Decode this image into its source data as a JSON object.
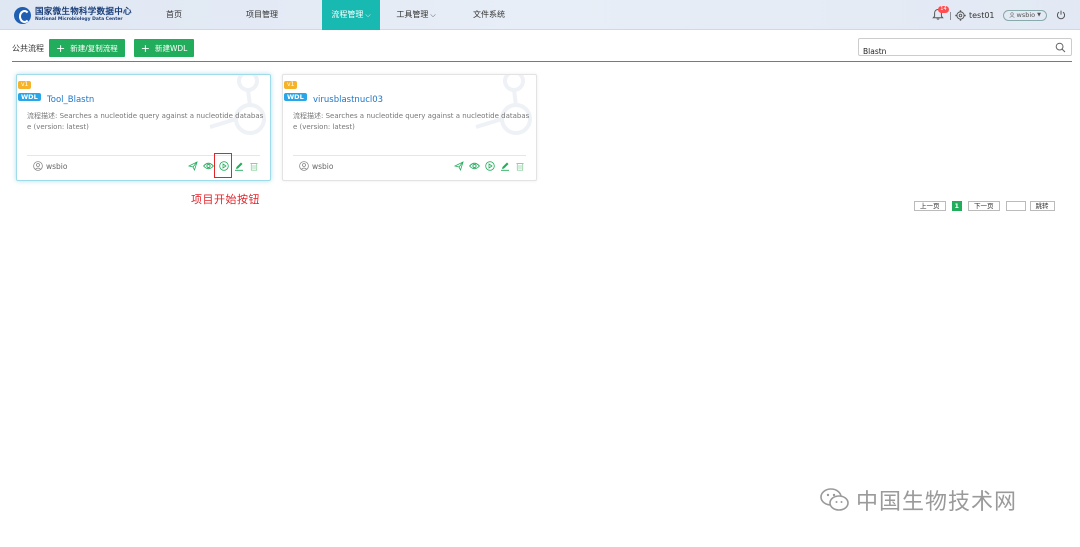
{
  "header": {
    "logo_cn": "国家微生物科学数据中心",
    "logo_en": "National Microbiology Data Center",
    "nav": [
      {
        "label": "首页",
        "chevron": false,
        "active": false
      },
      {
        "label": "项目管理",
        "chevron": false,
        "active": false
      },
      {
        "label": "流程管理",
        "chevron": true,
        "active": true
      },
      {
        "label": "工具管理",
        "chevron": true,
        "active": false
      },
      {
        "label": "文件系统",
        "chevron": false,
        "active": false
      }
    ],
    "notification_count": "14",
    "separator": "|",
    "username": "test01",
    "role": "wsbio"
  },
  "toolbar": {
    "breadcrumb": "公共流程",
    "new_copy_label": "新建/复制流程",
    "new_wdl_label": "新建WDL"
  },
  "search": {
    "value": "Blastn",
    "placeholder": ""
  },
  "cards": [
    {
      "version": "v1",
      "type": "WDL",
      "title": "Tool_Blastn",
      "description": "流程描述: Searches a nucleotide query against a nucleotide database (version: latest)",
      "owner": "wsbio"
    },
    {
      "version": "v1",
      "type": "WDL",
      "title": "virusblastnucl03",
      "description": "流程描述: Searches a nucleotide query against a nucleotide database (version: latest)",
      "owner": "wsbio"
    }
  ],
  "annotation": "项目开始按钮",
  "pagination": {
    "prev": "上一页",
    "current": "1",
    "next": "下一页",
    "jump": "跳转"
  },
  "watermark": "中国生物技术网",
  "colors": {
    "accent": "#17b9b0",
    "green": "#22ad5c",
    "link": "#1d76c9",
    "highlight": "#e3242b"
  }
}
